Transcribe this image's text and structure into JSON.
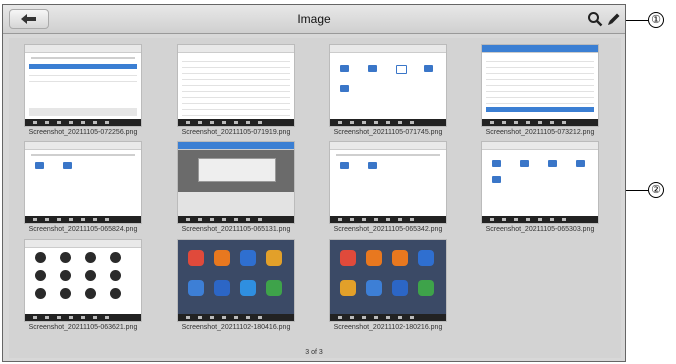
{
  "titlebar": {
    "title": "Image"
  },
  "thumbnails": [
    {
      "caption": "Screenshot_20211105-072256.png"
    },
    {
      "caption": "Screenshot_20211105-071919.png"
    },
    {
      "caption": "Screenshot_20211105-071745.png"
    },
    {
      "caption": "Screenshot_20211105-073212.png"
    },
    {
      "caption": "Screenshot_20211105-065824.png"
    },
    {
      "caption": "Screenshot_20211105-065131.png"
    },
    {
      "caption": "Screenshot_20211105-065342.png"
    },
    {
      "caption": "Screenshot_20211105-065303.png"
    },
    {
      "caption": "Screenshot_20211105-063621.png"
    },
    {
      "caption": "Screenshot_20211102-180416.png"
    },
    {
      "caption": "Screenshot_20211102-180216.png"
    }
  ],
  "pagination": {
    "text": "3 of 3"
  },
  "callouts": {
    "one": "①",
    "two": "②"
  },
  "icons": {
    "back": "back-arrow-icon",
    "search": "search-icon",
    "edit": "pencil-icon"
  }
}
